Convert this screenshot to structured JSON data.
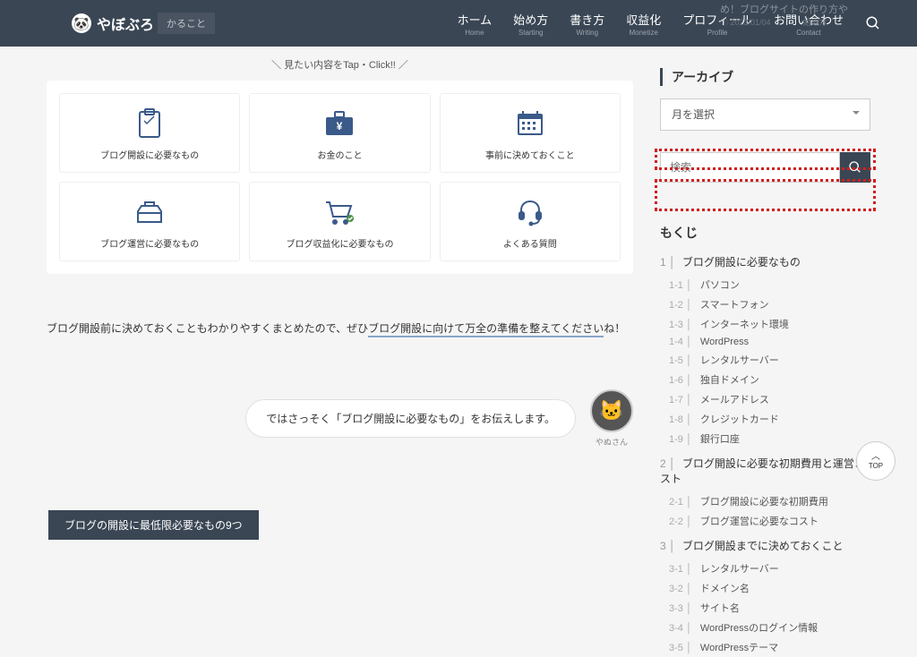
{
  "header": {
    "logo_text": "やぼぶろ",
    "tooltip": "かること",
    "ghost_title": "め！ブログサイトの作り方や",
    "ghost_date": "① 2023/01/04　　　　始め方",
    "nav": [
      {
        "jp": "ホーム",
        "en": "Home"
      },
      {
        "jp": "始め方",
        "en": "Starting"
      },
      {
        "jp": "書き方",
        "en": "Writing"
      },
      {
        "jp": "収益化",
        "en": "Monetize"
      },
      {
        "jp": "プロフィール",
        "en": "Profile"
      },
      {
        "jp": "お問い合わせ",
        "en": "Contact"
      }
    ]
  },
  "tap_click": "＼ 見たい内容をTap・Click!! ／",
  "cards": [
    {
      "label": "ブログ開設に必要なもの"
    },
    {
      "label": "お金のこと"
    },
    {
      "label": "事前に決めておくこと"
    },
    {
      "label": "ブログ運営に必要なもの"
    },
    {
      "label": "ブログ収益化に必要なもの"
    },
    {
      "label": "よくある質問"
    }
  ],
  "body_text": {
    "pre": "ブログ開設前に決めておくこともわかりやすくまとめたので、ぜひ",
    "ul": "ブログ開設に向けて万全の準備を整えてください",
    "post": "ね！"
  },
  "speech": {
    "text": "ではさっそく「ブログ開設に必要なもの」をお伝えします。",
    "name": "やぬさん"
  },
  "tag_block": "ブログの開設に最低限必要なもの9つ",
  "sidebar": {
    "archive_h": "アーカイブ",
    "archive_select": "月を選択",
    "search_placeholder": "検索",
    "toc_h": "もくじ",
    "sections": [
      {
        "num": "1",
        "title": "ブログ開設に必要なもの",
        "items": [
          {
            "n": "1-1",
            "t": "パソコン"
          },
          {
            "n": "1-2",
            "t": "スマートフォン"
          },
          {
            "n": "1-3",
            "t": "インターネット環境"
          },
          {
            "n": "1-4",
            "t": "WordPress"
          },
          {
            "n": "1-5",
            "t": "レンタルサーバー"
          },
          {
            "n": "1-6",
            "t": "独自ドメイン"
          },
          {
            "n": "1-7",
            "t": "メールアドレス"
          },
          {
            "n": "1-8",
            "t": "クレジットカード"
          },
          {
            "n": "1-9",
            "t": "銀行口座"
          }
        ]
      },
      {
        "num": "2",
        "title": "ブログ開設に必要な初期費用と運営コスト",
        "items": [
          {
            "n": "2-1",
            "t": "ブログ開設に必要な初期費用"
          },
          {
            "n": "2-2",
            "t": "ブログ運営に必要なコスト"
          }
        ]
      },
      {
        "num": "3",
        "title": "ブログ開設までに決めておくこと",
        "items": [
          {
            "n": "3-1",
            "t": "レンタルサーバー"
          },
          {
            "n": "3-2",
            "t": "ドメイン名"
          },
          {
            "n": "3-3",
            "t": "サイト名"
          },
          {
            "n": "3-4",
            "t": "WordPressのログイン情報"
          },
          {
            "n": "3-5",
            "t": "WordPressテーマ"
          }
        ]
      }
    ]
  },
  "to_top": "TOP"
}
